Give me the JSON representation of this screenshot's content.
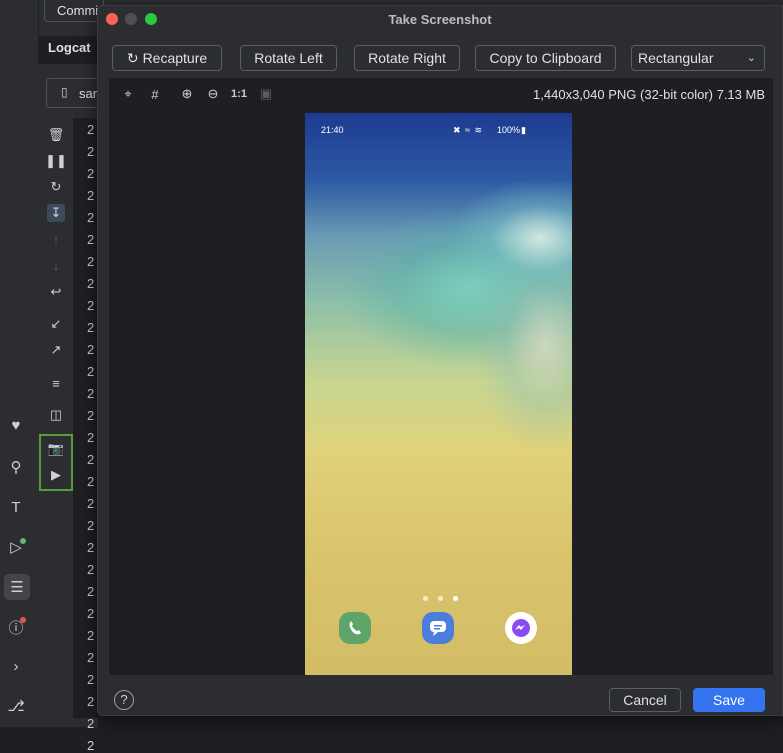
{
  "ide": {
    "commit_tab": "Commit",
    "logcat_title": "Logcat",
    "device_prefix": "sar",
    "log_lines": [
      "2",
      "2",
      "2",
      "2",
      "2",
      "2",
      "2",
      "2",
      "2",
      "2",
      "2",
      "2",
      "2",
      "2",
      "2",
      "2",
      "2",
      "2",
      "2",
      "2",
      "2",
      "2",
      "2",
      "2",
      "2",
      "2",
      "2",
      "2",
      "2"
    ]
  },
  "dialog": {
    "title": "Take Screenshot",
    "buttons": {
      "recapture": "Recapture",
      "rotate_left": "Rotate Left",
      "rotate_right": "Rotate Right",
      "copy": "Copy to Clipboard"
    },
    "mode_select": "Rectangular",
    "zoom_actual": "1:1",
    "image_info": "1,440x3,040 PNG (32-bit color) 7.13 MB",
    "phone": {
      "time": "21:40",
      "battery": "100%",
      "page_dots": 3,
      "active_dot": 2,
      "apps": [
        "phone-app-icon",
        "messages-app-icon",
        "messenger-app-icon"
      ]
    },
    "help": "?",
    "cancel": "Cancel",
    "save": "Save"
  },
  "colors": {
    "accent": "#3574f0",
    "highlight_border": "#5a9a3a",
    "close": "#ff5f57",
    "minimize": "#4d4f55",
    "maximize": "#28c840"
  }
}
